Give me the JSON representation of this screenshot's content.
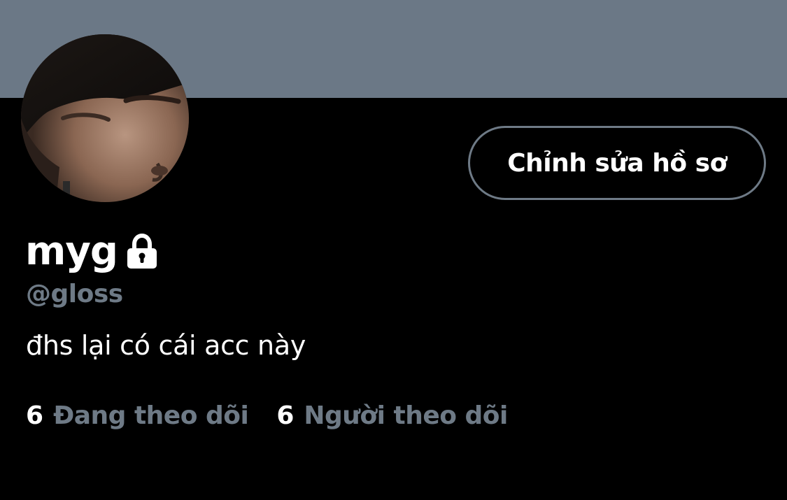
{
  "colors": {
    "banner": "#6b7886",
    "background": "#000000",
    "text_primary": "#ffffff",
    "text_secondary": "#6e7a86",
    "button_border": "#6e7a86"
  },
  "profile": {
    "avatar_icon": "user-avatar-photo",
    "edit_button_label": "Chỉnh sửa hồ sơ",
    "display_name": "myg",
    "protected_icon": "lock-icon",
    "handle": "@gloss",
    "bio": "đhs lại có cái acc này",
    "following": {
      "count": "6",
      "label": "Đang theo dõi"
    },
    "followers": {
      "count": "6",
      "label": "Người theo dõi"
    }
  }
}
